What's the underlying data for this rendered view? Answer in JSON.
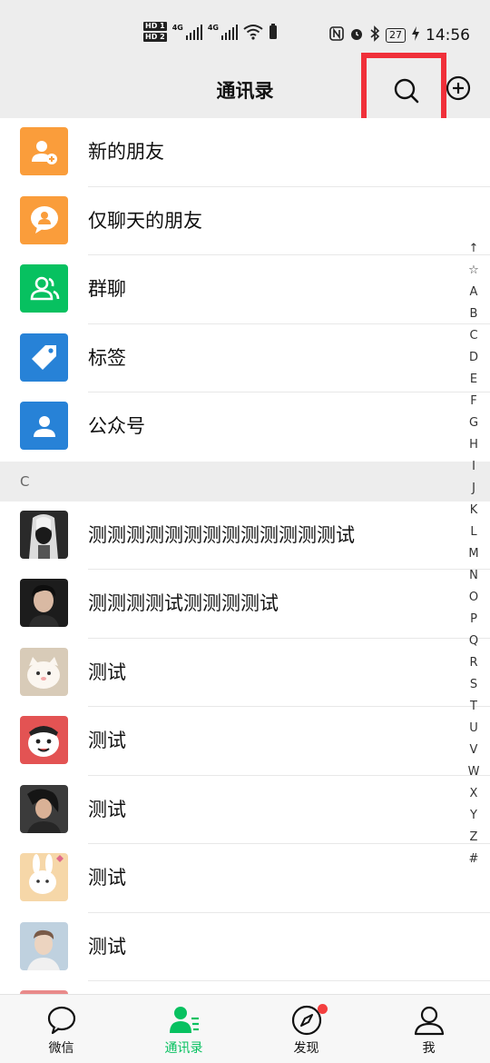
{
  "status_bar": {
    "hd1": "HD 1",
    "hd2": "HD 2",
    "net1": "4G",
    "net2": "4G",
    "battery": "27",
    "time": "14:56"
  },
  "header": {
    "title": "通讯录"
  },
  "function_items": [
    {
      "label": "新的朋友",
      "color": "#fa9d3b",
      "icon": "add-friend-icon"
    },
    {
      "label": "仅聊天的朋友",
      "color": "#fa9d3b",
      "icon": "chat-only-friend-icon"
    },
    {
      "label": "群聊",
      "color": "#07c160",
      "icon": "group-chat-icon"
    },
    {
      "label": "标签",
      "color": "#2782d7",
      "icon": "tag-icon"
    },
    {
      "label": "公众号",
      "color": "#2782d7",
      "icon": "official-account-icon"
    }
  ],
  "section_c": {
    "letter": "C",
    "contacts": [
      {
        "name": "测测测测测测测测测测测测测试"
      },
      {
        "name": "测测测测试测测测测试"
      },
      {
        "name": "测试"
      },
      {
        "name": "测试"
      },
      {
        "name": "测试"
      },
      {
        "name": "测试"
      },
      {
        "name": "测试"
      }
    ]
  },
  "index_letters": [
    "↑",
    "☆",
    "A",
    "B",
    "C",
    "D",
    "E",
    "F",
    "G",
    "H",
    "I",
    "J",
    "K",
    "L",
    "M",
    "N",
    "O",
    "P",
    "Q",
    "R",
    "S",
    "T",
    "U",
    "V",
    "W",
    "X",
    "Y",
    "Z",
    "#"
  ],
  "tabs": [
    {
      "label": "微信",
      "icon": "chat-bubble-icon"
    },
    {
      "label": "通讯录",
      "icon": "contacts-icon"
    },
    {
      "label": "发现",
      "icon": "compass-icon"
    },
    {
      "label": "我",
      "icon": "profile-icon"
    }
  ],
  "colors": {
    "accent": "#07c160",
    "highlight_box": "#f0303a",
    "badge": "#f43f3f"
  }
}
